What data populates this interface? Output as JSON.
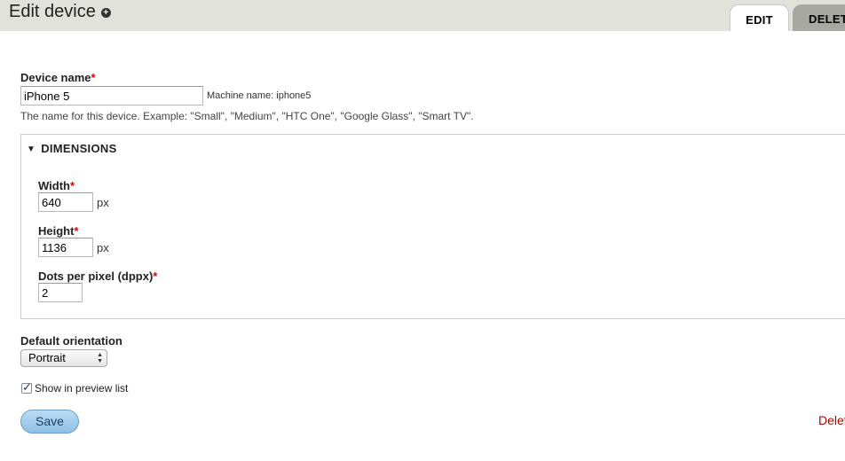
{
  "header": {
    "title": "Edit device",
    "title_icon": "plus-circle-icon",
    "tabs": [
      {
        "label": "EDIT",
        "active": true
      },
      {
        "label": "DELETE",
        "active": false
      }
    ]
  },
  "form": {
    "device_name": {
      "label": "Device name",
      "required_marker": "*",
      "value": "iPhone 5",
      "machine_name": "Machine name: iphone5",
      "description": "The name for this device. Example: \"Small\", \"Medium\", \"HTC One\", \"Google Glass\", \"Smart TV\"."
    },
    "dimensions": {
      "legend": "DIMENSIONS",
      "expanded": true,
      "width": {
        "label": "Width",
        "required_marker": "*",
        "value": "640",
        "unit": "px"
      },
      "height": {
        "label": "Height",
        "required_marker": "*",
        "value": "1136",
        "unit": "px"
      },
      "dppx": {
        "label": "Dots per pixel (dppx)",
        "required_marker": "*",
        "value": "2"
      }
    },
    "orientation": {
      "label": "Default orientation",
      "selected": "Portrait"
    },
    "show_in_preview": {
      "label": "Show in preview list",
      "checked": true
    },
    "actions": {
      "save_label": "Save",
      "delete_label": "Delete"
    }
  },
  "colors": {
    "header_bg": "#e1e2dc",
    "required": "#e00000",
    "save_button": "#a6cfee",
    "delete_link": "#b30000"
  }
}
